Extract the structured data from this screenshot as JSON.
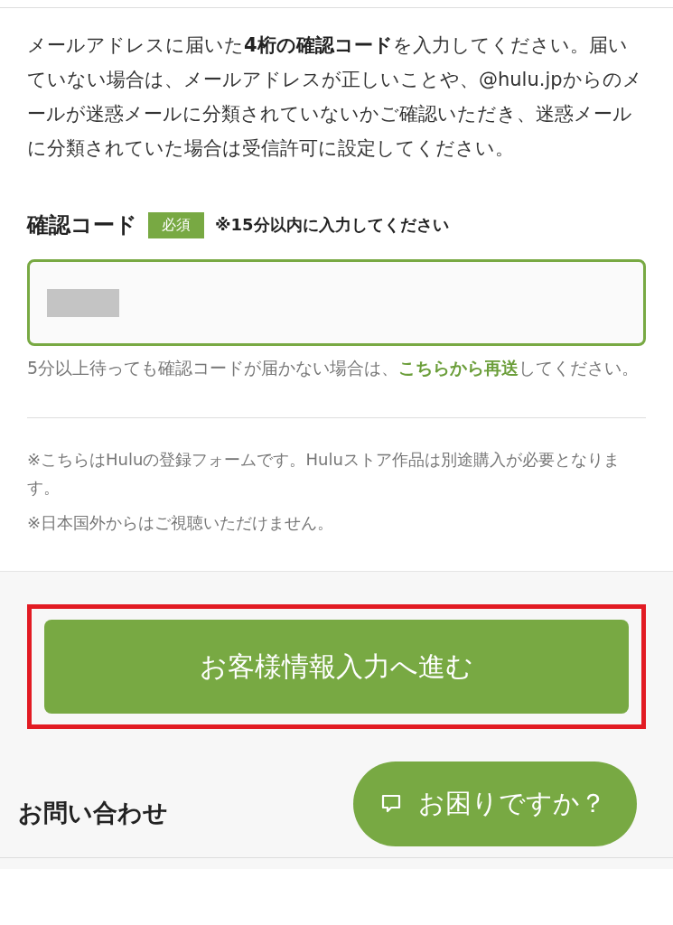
{
  "intro": "メールアドレスに届いた**4桁の確認コード**を入力してください。届いていない場合は、メールアドレスが正しいことや、@hulu.jpからのメールが迷惑メールに分類されていないかご確認いただき、迷惑メールに分類されていた場合は受信許可に設定してください。",
  "field": {
    "label": "確認コード",
    "required_badge": "必須",
    "note": "※15分以内に入力してください",
    "value_redacted": true,
    "focused": true
  },
  "resend": {
    "before": "5分以上待っても確認コードが届かない場合は、",
    "link": "こちらから再送",
    "after": "してください。"
  },
  "notes": [
    "※こちらはHuluの登録フォームです。Huluストア作品は別途購入が必要となります。",
    "※日本国外からはご視聴いただけません。"
  ],
  "submit": {
    "label": "お客様情報入力へ進む",
    "highlighted": true
  },
  "contact_heading": "お問い合わせ",
  "help_button": {
    "label": "お困りですか？"
  }
}
